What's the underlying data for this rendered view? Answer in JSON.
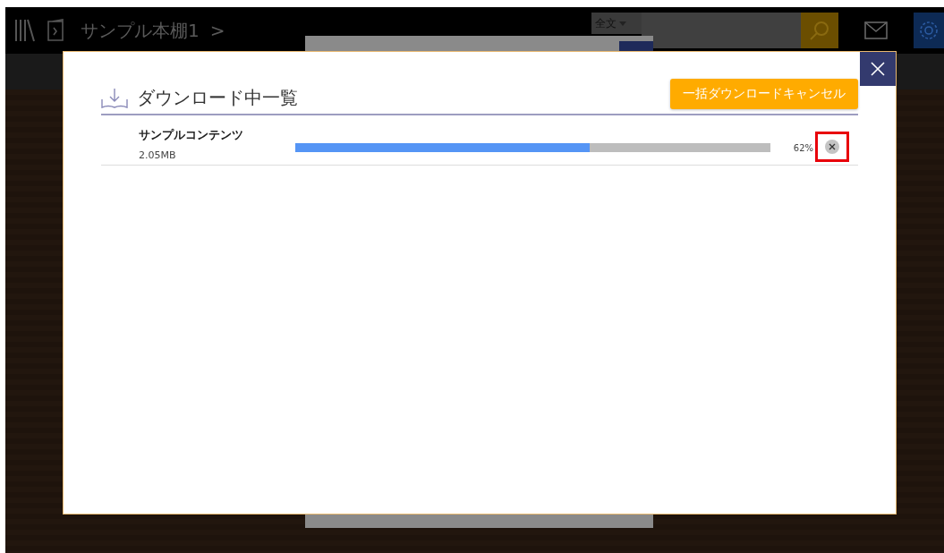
{
  "header": {
    "shelf_title": "サンプル本棚1",
    "chevron": ">",
    "search_scope": "全文"
  },
  "dialog": {
    "title": "ダウンロード中一覧",
    "cancel_all_button": "一括ダウンロードキャンセル",
    "items": [
      {
        "name": "サンプルコンテンツ",
        "size": "2.05MB",
        "level": 0.62,
        "percent": "62%",
        "highlighted": true
      }
    ]
  }
}
